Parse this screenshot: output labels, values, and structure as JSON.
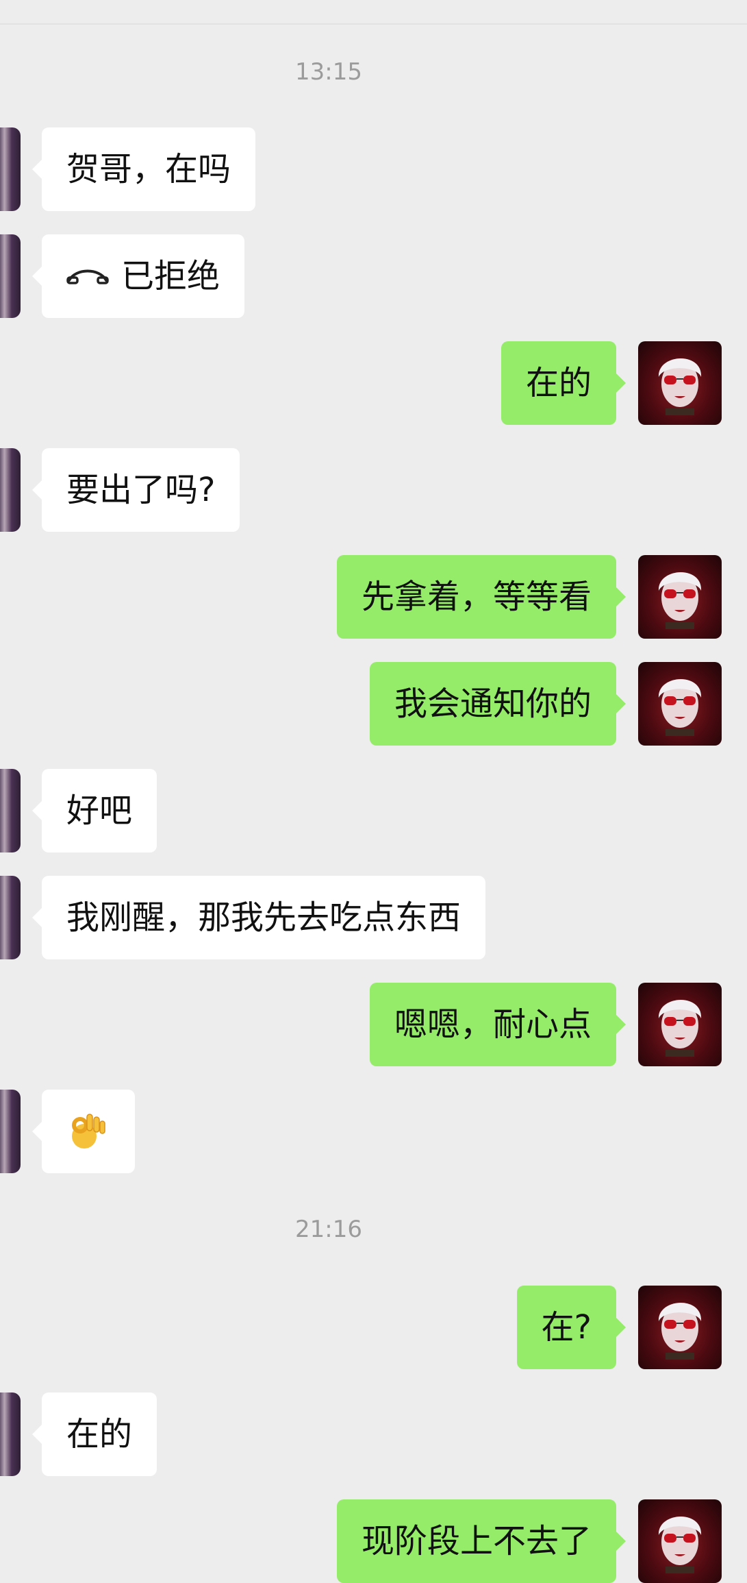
{
  "timestamps": [
    "13:15",
    "21:16"
  ],
  "messages": [
    {
      "side": "in",
      "text": "贺哥，在吗"
    },
    {
      "side": "in",
      "text": "已拒绝",
      "icon": "phone-hangup-icon"
    },
    {
      "side": "out",
      "text": "在的"
    },
    {
      "side": "in",
      "text": "要出了吗?"
    },
    {
      "side": "out",
      "text": "先拿着，等等看"
    },
    {
      "side": "out",
      "text": "我会通知你的"
    },
    {
      "side": "in",
      "text": "好吧"
    },
    {
      "side": "in",
      "text": "我刚醒，那我先去吃点东西"
    },
    {
      "side": "out",
      "text": "嗯嗯，耐心点"
    },
    {
      "side": "in",
      "text": "",
      "icon": "ok-hand-emoji-icon"
    },
    {
      "side": "out",
      "text": "在?"
    },
    {
      "side": "in",
      "text": "在的"
    },
    {
      "side": "out",
      "text": "现阶段上不去了"
    }
  ],
  "colors": {
    "background": "#ededed",
    "incoming_bubble": "#ffffff",
    "outgoing_bubble": "#95ec69",
    "timestamp_text": "#9b9b9b"
  }
}
